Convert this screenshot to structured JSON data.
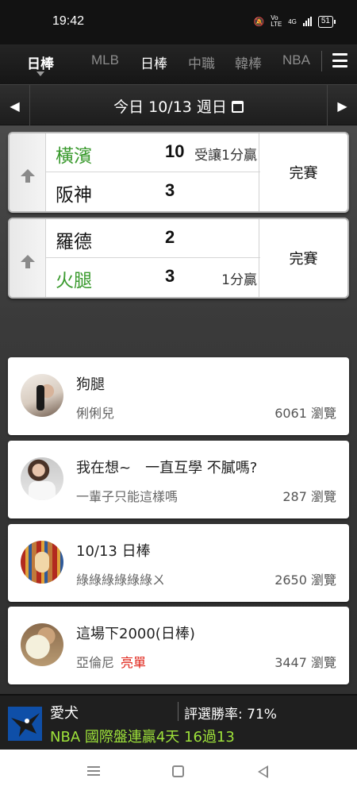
{
  "status_bar": {
    "time": "19:42",
    "network": "4G",
    "volte": "Vo LTE",
    "battery": "51"
  },
  "nav": {
    "current_sport": "日棒",
    "tabs": [
      {
        "label": "MLB",
        "active": false
      },
      {
        "label": "日棒",
        "active": true
      },
      {
        "label": "中職",
        "active": false
      },
      {
        "label": "韓棒",
        "active": false
      },
      {
        "label": "NBA",
        "active": false
      }
    ]
  },
  "date_bar": {
    "label": "今日 10/13 週日"
  },
  "games": [
    {
      "status": "完賽",
      "teams": [
        {
          "name": "橫濱",
          "score": "10",
          "note": "受讓1分贏",
          "winner": true
        },
        {
          "name": "阪神",
          "score": "3",
          "note": "",
          "winner": false
        }
      ]
    },
    {
      "status": "完賽",
      "teams": [
        {
          "name": "羅德",
          "score": "2",
          "note": "",
          "winner": false
        },
        {
          "name": "火腿",
          "score": "3",
          "note": "1分贏",
          "winner": true
        }
      ]
    }
  ],
  "posts": [
    {
      "title": "狗腿",
      "author": "俐俐兒",
      "tag": "",
      "views": "6061 瀏覽"
    },
    {
      "title": "我在想~　一直互學 不膩嗎?",
      "author": "一輩子只能這樣嗎",
      "tag": "",
      "views": "287 瀏覽"
    },
    {
      "title": "10/13 日棒",
      "author": "綠綠綠綠綠綠ㄨ",
      "tag": "",
      "views": "2650 瀏覽"
    },
    {
      "title": "這場下2000(日棒)",
      "author": "亞倫尼",
      "tag": "亮單",
      "views": "3447 瀏覽"
    }
  ],
  "banner": {
    "user": "愛犬",
    "win_rate": "評選勝率: 71%",
    "promo": "NBA 國際盤連贏4天 16過13"
  },
  "colors": {
    "win_green": "#3a9a2e",
    "promo_green": "#9ee23a",
    "tag_red": "#e0261b"
  }
}
